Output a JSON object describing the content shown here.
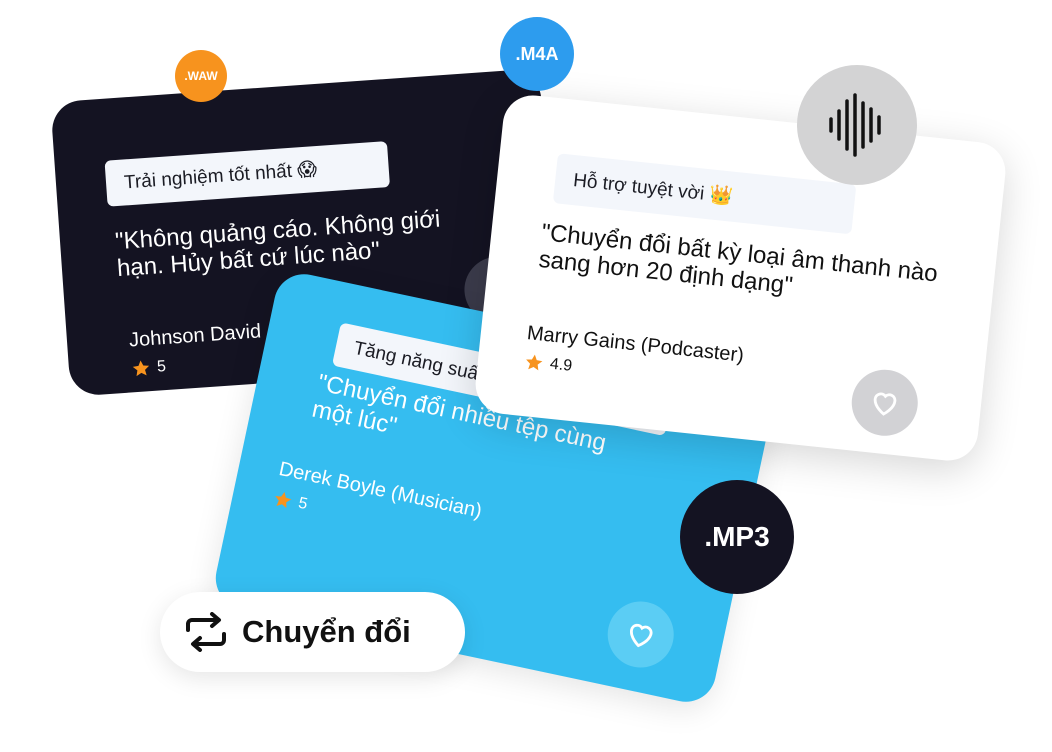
{
  "cards": [
    {
      "id": "dark",
      "tag": "Trải nghiệm tốt nhất 😱",
      "quote": "\"Không quảng cáo. Không giới hạn. Hủy bất cứ lúc nào\"",
      "author": "Johnson David",
      "rating": "5"
    },
    {
      "id": "white",
      "tag": "Hỗ trợ tuyệt vời 👑",
      "quote": "\"Chuyển đổi bất kỳ loại âm thanh nào sang hơn 20 định dạng\"",
      "author": "Marry Gains (Podcaster)",
      "rating": "4.9"
    },
    {
      "id": "blue",
      "tag": "Tăng năng suất 🚀",
      "quote": "\"Chuyển đổi nhiều tệp cùng một lúc\"",
      "author": "Derek Boyle (Musician)",
      "rating": "5"
    }
  ],
  "badges": {
    "waw": ".WAW",
    "m4a": ".M4A",
    "mp3": ".MP3"
  },
  "convert_button": {
    "label": "Chuyển đổi"
  },
  "icons": {
    "waveform": "waveform-icon",
    "heart": "heart-icon",
    "star": "star-icon",
    "convert": "repeat-icon"
  },
  "colors": {
    "dark_card": "#141322",
    "blue_card": "#35bdf0",
    "star": "#f7931e",
    "waw_badge": "#f7931e",
    "m4a_badge": "#2d9cee"
  }
}
